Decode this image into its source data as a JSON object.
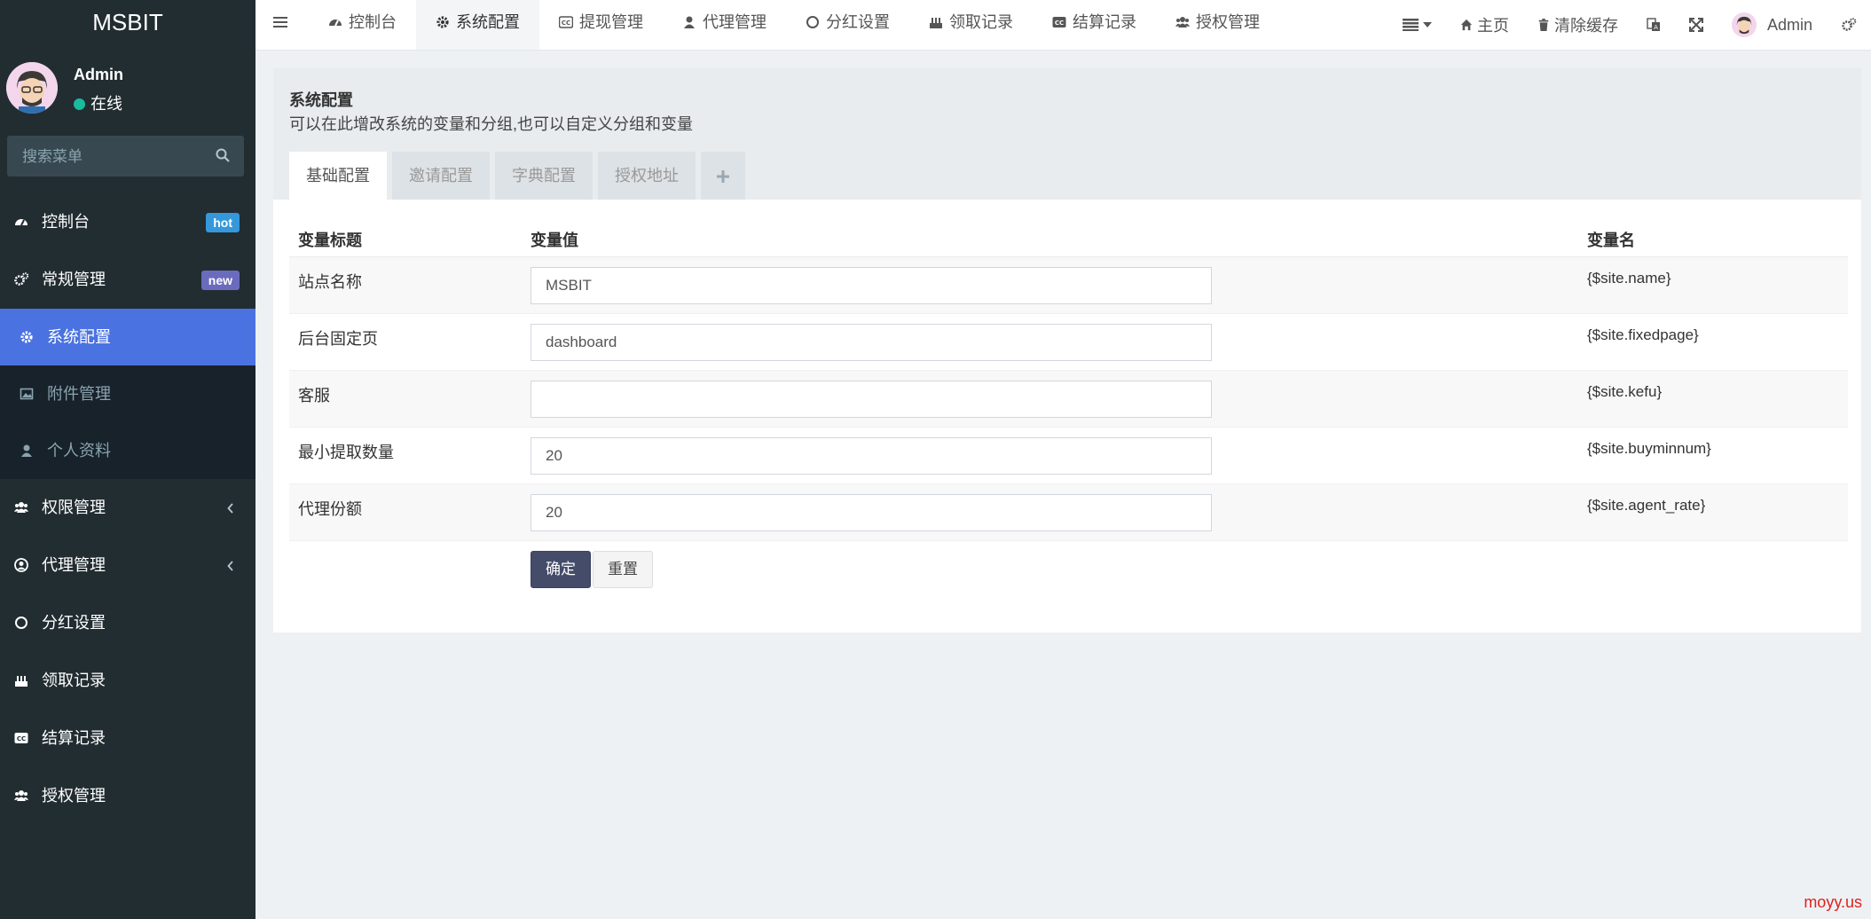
{
  "app": {
    "logo": "MSBIT"
  },
  "user": {
    "name": "Admin",
    "status": "在线"
  },
  "sidebar": {
    "search_placeholder": "搜索菜单",
    "items": [
      {
        "label": "控制台",
        "icon": "dashboard-icon",
        "badge": "hot"
      },
      {
        "label": "常规管理",
        "icon": "cogs-icon",
        "badge": "new"
      },
      {
        "label": "权限管理",
        "icon": "users-icon"
      },
      {
        "label": "代理管理",
        "icon": "user-circle-icon"
      },
      {
        "label": "分红设置",
        "icon": "circle-icon"
      },
      {
        "label": "领取记录",
        "icon": "birthday-cake-icon"
      },
      {
        "label": "结算记录",
        "icon": "cc-icon"
      },
      {
        "label": "授权管理",
        "icon": "users-icon"
      }
    ],
    "sub_items": [
      {
        "label": "系统配置",
        "icon": "gear-icon"
      },
      {
        "label": "附件管理",
        "icon": "image-icon"
      },
      {
        "label": "个人资料",
        "icon": "user-icon"
      }
    ]
  },
  "topnav": {
    "tabs": [
      {
        "label": "控制台",
        "icon": "dashboard-icon"
      },
      {
        "label": "系统配置",
        "icon": "gear-icon"
      },
      {
        "label": "提现管理",
        "icon": "cc-icon"
      },
      {
        "label": "代理管理",
        "icon": "user-icon"
      },
      {
        "label": "分红设置",
        "icon": "circle-icon"
      },
      {
        "label": "领取记录",
        "icon": "birthday-cake-icon"
      },
      {
        "label": "结算记录",
        "icon": "cc-icon"
      },
      {
        "label": "授权管理",
        "icon": "users-icon"
      }
    ],
    "home_label": "主页",
    "clear_cache_label": "清除缓存",
    "user_name": "Admin"
  },
  "panel": {
    "title": "系统配置",
    "description": "可以在此增改系统的变量和分组,也可以自定义分组和变量",
    "tabs": [
      "基础配置",
      "邀请配置",
      "字典配置",
      "授权地址"
    ],
    "add_tab": "+"
  },
  "config_table": {
    "headers": {
      "title": "变量标题",
      "value": "变量值",
      "name": "变量名"
    },
    "rows": [
      {
        "title": "站点名称",
        "value": "MSBIT",
        "name": "{$site.name}"
      },
      {
        "title": "后台固定页",
        "value": "dashboard",
        "name": "{$site.fixedpage}"
      },
      {
        "title": "客服",
        "value": "",
        "name": "{$site.kefu}"
      },
      {
        "title": "最小提取数量",
        "value": "20",
        "name": "{$site.buyminnum}"
      },
      {
        "title": "代理份额",
        "value": "20",
        "name": "{$site.agent_rate}"
      }
    ],
    "submit_label": "确定",
    "reset_label": "重置"
  },
  "watermark": "moyy.us",
  "colors": {
    "sidebar_bg": "#222d32",
    "active_item": "#4a72e0",
    "primary_button": "#444c69",
    "online_dot": "#18bc9c",
    "badge_hot": "#3498db",
    "badge_new": "#6b6bbd"
  }
}
